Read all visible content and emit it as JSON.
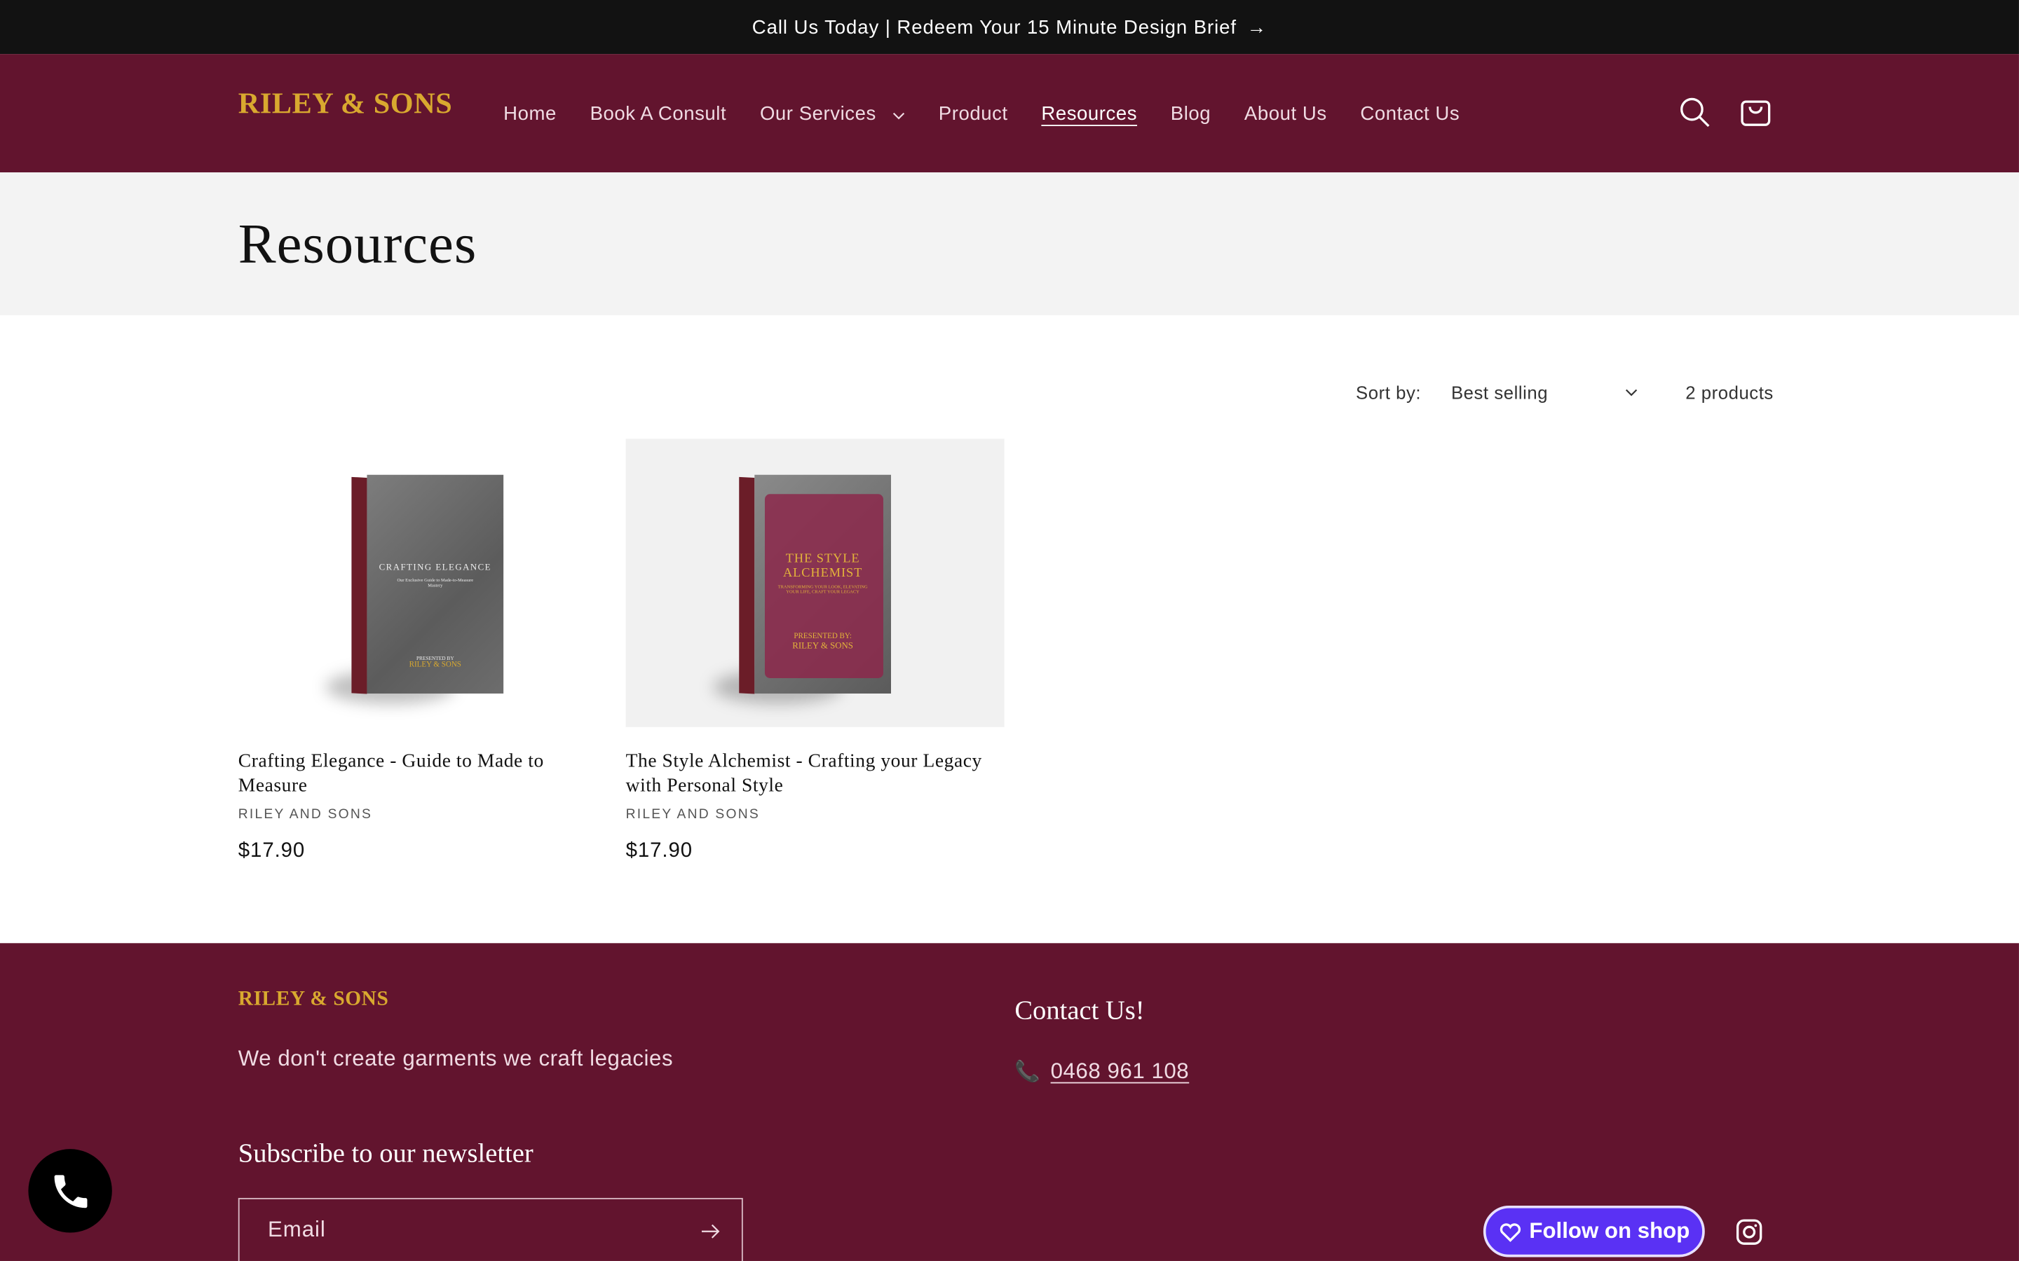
{
  "announcement": {
    "text": "Call Us Today | Redeem Your 15 Minute Design Brief",
    "arrow": "→"
  },
  "brand": {
    "logo": "RILEY & SONS",
    "colors": {
      "header": "#62142e",
      "gold": "#d9a92f",
      "shop": "#5a31f4"
    }
  },
  "nav": {
    "items": [
      {
        "label": "Home"
      },
      {
        "label": "Book A Consult"
      },
      {
        "label": "Our Services"
      },
      {
        "label": "Product"
      },
      {
        "label": "Resources"
      },
      {
        "label": "Blog"
      },
      {
        "label": "About Us"
      },
      {
        "label": "Contact Us"
      }
    ]
  },
  "page": {
    "title": "Resources"
  },
  "sort": {
    "label": "Sort by:",
    "value": "Best selling",
    "count": "2 products"
  },
  "products": [
    {
      "title": "Crafting Elegance - Guide to Made to Measure",
      "vendor": "RILEY AND SONS",
      "price": "$17.90",
      "cover_title": "CRAFTING ELEGANCE",
      "cover_sub": "Our Exclusive Guide to Made-to-Measure Mastery",
      "cover_presented": "PRESENTED BY",
      "cover_brand": "RILEY & SONS"
    },
    {
      "title": "The Style Alchemist - Crafting your Legacy with Personal Style",
      "vendor": "RILEY AND SONS",
      "price": "$17.90",
      "cover_title": "THE STYLE ALCHEMIST",
      "cover_sub": "TRANSFORMING YOUR LOOK, ELEVATING YOUR LIFE, CRAFT YOUR LEGACY",
      "cover_presented": "PRESENTED BY:",
      "cover_brand": "RILEY & SONS"
    }
  ],
  "footer": {
    "logo": "RILEY & SONS",
    "tagline": "We don't create garments we craft legacies",
    "contact_heading": "Contact Us!",
    "phone": "0468 961 108",
    "newsletter_heading": "Subscribe to our newsletter",
    "email_placeholder": "Email",
    "follow_label": "Follow on shop"
  }
}
